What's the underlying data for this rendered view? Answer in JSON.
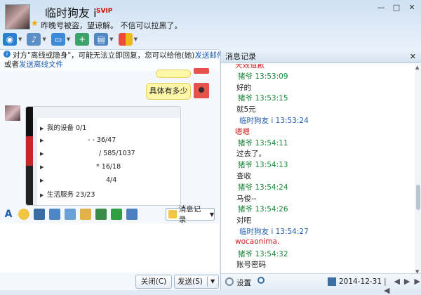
{
  "header": {
    "title": "临时狗友 i",
    "vip_label": "SVIP",
    "signature": "昨晚号被盗，望谅解。 不信可以拉黑了。"
  },
  "window_controls": [
    "—",
    "□",
    "✕"
  ],
  "toolbar_icons": [
    "video-call-icon",
    "voice-call-icon",
    "transfer-file-icon",
    "remote-assist-icon",
    "screen-share-icon",
    "apps-icon"
  ],
  "info_bar": {
    "line1_text": "对方\"离线或隐身\"，可能无法立即回复，您可以给他(她)",
    "line1_link": "发送邮件",
    "line2_prefix": "或者",
    "line2_link": "发送离线文件"
  },
  "chat": {
    "bubble_text": "具体有多少",
    "card_rows": [
      {
        "text": "我的设备 0/1"
      },
      {
        "text": "- - 36/47"
      },
      {
        "text": "/ 585/1037"
      },
      {
        "text": "* 16/18"
      },
      {
        "text": "4/4"
      },
      {
        "text": "生活服务 23/23"
      }
    ]
  },
  "input_toolbar": {
    "history_button": "消息记录"
  },
  "buttons": {
    "close": "关闭(C)",
    "send": "发送(S)"
  },
  "history": {
    "title": "消息记录",
    "close": "✕",
    "messages": [
      {
        "text": "天效道歉",
        "cls": "red"
      },
      {
        "text": "猪爷 13:53:09",
        "cls": "sender"
      },
      {
        "text": "好的",
        "cls": ""
      },
      {
        "text": "猪爷 13:53:15",
        "cls": "sender"
      },
      {
        "text": "就5元",
        "cls": ""
      },
      {
        "text": "临时狗友 i 13:53:24",
        "cls": "sender2"
      },
      {
        "text": "嗯嗯",
        "cls": "red"
      },
      {
        "text": "猪爷 13:54:11",
        "cls": "sender"
      },
      {
        "text": "过去了。",
        "cls": ""
      },
      {
        "text": "猪爷 13:54:13",
        "cls": "sender"
      },
      {
        "text": "查收",
        "cls": ""
      },
      {
        "text": "猪爷 13:54:24",
        "cls": "sender"
      },
      {
        "text": "马俊--",
        "cls": ""
      },
      {
        "text": "猪爷 13:54:26",
        "cls": "sender"
      },
      {
        "text": "对吧",
        "cls": ""
      },
      {
        "text": "临时狗友 i 13:54:27",
        "cls": "sender2"
      },
      {
        "text": "wocaonima.",
        "cls": "red"
      },
      {
        "text": "猪爷 13:54:32",
        "cls": "sender"
      },
      {
        "text": "账号密码",
        "cls": ""
      }
    ],
    "footer": {
      "settings": "设置",
      "date": "2014-12-31"
    }
  },
  "colors": {
    "accent": "#1e5fb0",
    "sender": "#1a8a3a",
    "alert": "#d21c1c"
  }
}
